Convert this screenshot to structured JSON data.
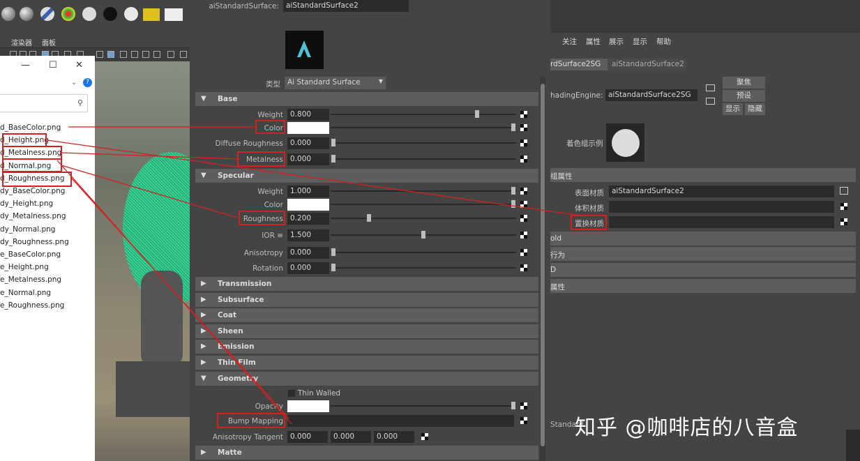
{
  "shelf": {
    "menu_render": "渲染器",
    "menu_panel": "面板"
  },
  "explorer": {
    "minimize": "—",
    "maximize": "☐",
    "close": "✕",
    "files": [
      "d_BaseColor.png",
      "d_Height.png",
      "d_Metalness.png",
      "d_Normal.png",
      "d_Roughness.png",
      "dy_BaseColor.png",
      "dy_Height.png",
      "dy_Metalness.png",
      "dy_Normal.png",
      "dy_Roughness.png",
      "e_BaseColor.png",
      "e_Height.png",
      "e_Metalness.png",
      "e_Normal.png",
      "e_Roughness.png"
    ]
  },
  "attr": {
    "node_label": "aiStandardSurface:",
    "node_value": "aiStandardSurface2",
    "type_label": "类型",
    "type_value": "Ai Standard Surface",
    "base": {
      "title": "Base",
      "weight_label": "Weight",
      "weight": "0.800",
      "color_label": "Color",
      "diffuse_label": "Diffuse Roughness",
      "diffuse": "0.000",
      "metal_label": "Metalness",
      "metal": "0.000"
    },
    "specular": {
      "title": "Specular",
      "weight_label": "Weight",
      "weight": "1.000",
      "color_label": "Color",
      "rough_label": "Roughness",
      "rough": "0.200",
      "ior_label": "IOR ≡",
      "ior": "1.500",
      "aniso_label": "Anisotropy",
      "aniso": "0.000",
      "rot_label": "Rotation",
      "rot": "0.000"
    },
    "sections": [
      "Transmission",
      "Subsurface",
      "Coat",
      "Sheen",
      "Emission",
      "Thin Film"
    ],
    "geometry": {
      "title": "Geometry",
      "thin_walled": "Thin Walled",
      "opacity_label": "Opacity",
      "bump_label": "Bump Mapping",
      "tangent_label": "Anisotropy Tangent",
      "t1": "0.000",
      "t2": "0.000",
      "t3": "0.000"
    },
    "matte": "Matte"
  },
  "right": {
    "menus": [
      "关注",
      "属性",
      "展示",
      "显示",
      "帮助"
    ],
    "tab1": "rdSurface2SG",
    "tab2": "aiStandardSurface2",
    "sg_label": "hadingEngine:",
    "sg_value": "aiStandardSurface2SG",
    "btn_focus": "聚焦",
    "btn_preset": "预设",
    "btn_show": "显示",
    "btn_hide": "隐藏",
    "swatch_label": "着色组示例",
    "grp_attr": "组属性",
    "surf_label": "表面材质",
    "surf_value": "aiStandardSurface2",
    "vol_label": "体积材质",
    "disp_label": "置换材质",
    "rs1": "old",
    "rs2": "行为",
    "rs3": "D",
    "rs4": "属性",
    "bottom_text": "Standard"
  },
  "watermark": "知乎 @咖啡店的八音盒"
}
